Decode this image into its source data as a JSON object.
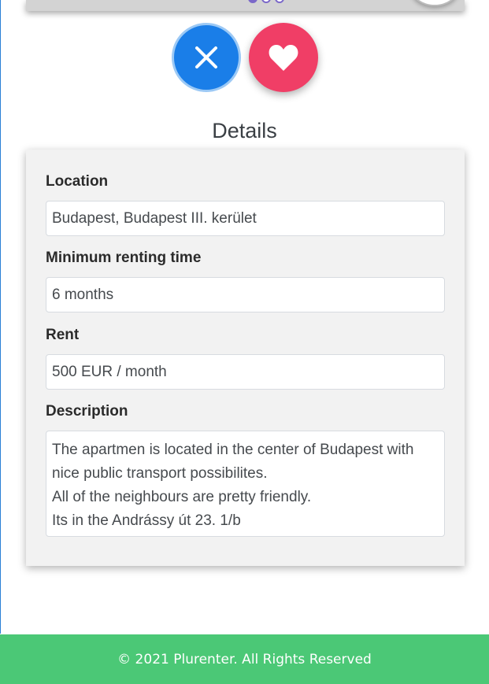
{
  "actions": {
    "dislike_icon": "close-icon",
    "like_icon": "heart-icon",
    "dislike_color": "#1a7ee8",
    "like_color": "#f03e66"
  },
  "carousel": {
    "dots": 3,
    "active_index": 0
  },
  "details": {
    "title": "Details",
    "location_label": "Location",
    "location_value": "Budapest, Budapest III. kerület",
    "min_time_label": "Minimum renting time",
    "min_time_value": "6 months",
    "rent_label": "Rent",
    "rent_value": "500 EUR / month",
    "description_label": "Description",
    "description_lines": [
      "The apartmen is located in the center of Budapest with",
      "nice public transport possibilites.",
      "All of the neighbours are pretty friendly.",
      "Its in the Andrássy út 23. 1/b"
    ]
  },
  "footer": {
    "text": "© 2021 Plurenter. All Rights Reserved",
    "color": "#4bc876"
  }
}
